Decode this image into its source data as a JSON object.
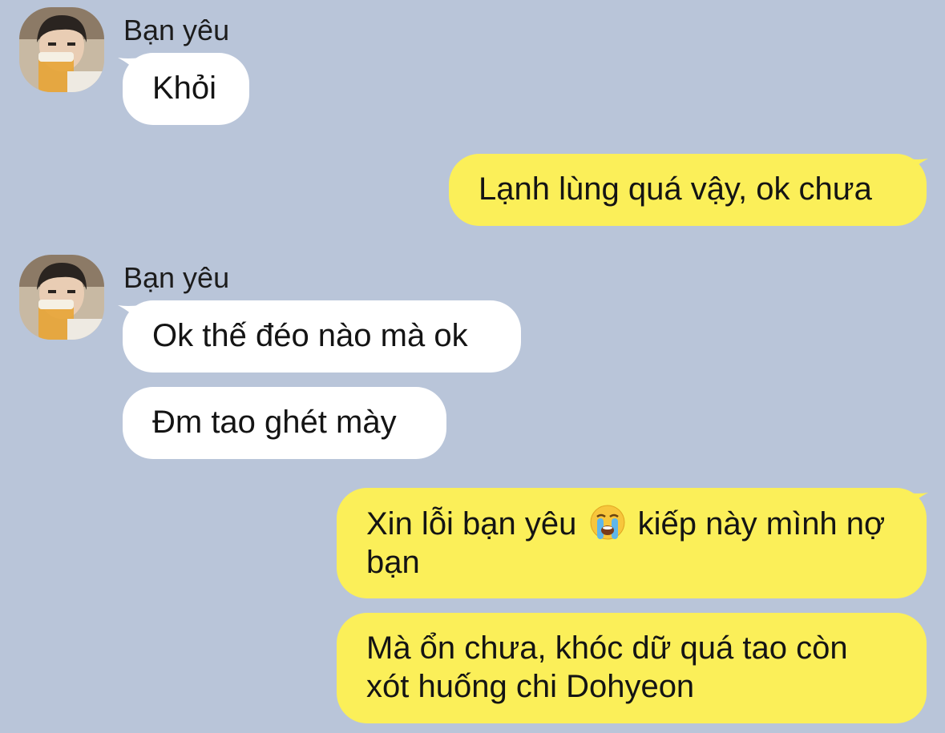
{
  "contact": {
    "name": "Bạn yêu"
  },
  "messages": [
    {
      "from": "contact",
      "text": "Khỏi"
    },
    {
      "from": "me",
      "text": "Lạnh lùng quá vậy, ok chưa"
    },
    {
      "from": "contact",
      "text": "Ok thế đéo nào mà ok"
    },
    {
      "from": "contact",
      "text": "Đm tao ghét mày"
    },
    {
      "from": "me",
      "text_before": "Xin lỗi bạn yêu",
      "emoji": "loudly-crying-face-icon",
      "text_after": "kiếp này mình nợ bạn"
    },
    {
      "from": "me",
      "text": "Mà ổn chưa, khóc dữ quá tao còn xót huống chi Dohyeon"
    }
  ],
  "colors": {
    "background": "#b9c5d9",
    "incoming_bubble": "#ffffff",
    "outgoing_bubble": "#fbef59"
  }
}
